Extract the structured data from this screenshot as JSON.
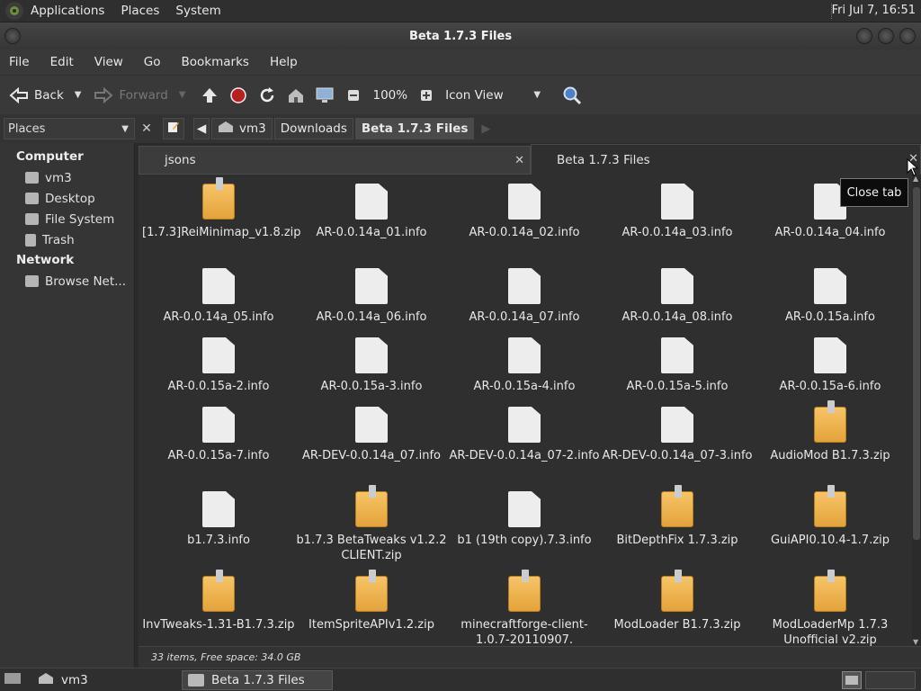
{
  "panel": {
    "menu": [
      "Applications",
      "Places",
      "System"
    ],
    "clock": "Fri Jul  7, 16:51"
  },
  "window": {
    "title": "Beta 1.7.3 Files"
  },
  "menubar": [
    "File",
    "Edit",
    "View",
    "Go",
    "Bookmarks",
    "Help"
  ],
  "toolbar": {
    "back": "Back",
    "forward": "Forward",
    "zoom": "100%",
    "view": "Icon View"
  },
  "sidebar": {
    "selector": "Places",
    "sections": [
      {
        "title": "Computer",
        "items": [
          "vm3",
          "Desktop",
          "File System",
          "Trash"
        ]
      },
      {
        "title": "Network",
        "items": [
          "Browse Net..."
        ]
      }
    ]
  },
  "breadcrumbs": [
    "vm3",
    "Downloads",
    "Beta 1.7.3 Files"
  ],
  "tabs": [
    {
      "label": "jsons",
      "active": false
    },
    {
      "label": "Beta 1.7.3 Files",
      "active": true
    }
  ],
  "tooltip": "Close tab",
  "files": [
    {
      "name": "[1.7.3]ReiMinimap_v1.8.zip",
      "type": "zip"
    },
    {
      "name": "AR-0.0.14a_01.info",
      "type": "doc"
    },
    {
      "name": "AR-0.0.14a_02.info",
      "type": "doc"
    },
    {
      "name": "AR-0.0.14a_03.info",
      "type": "doc"
    },
    {
      "name": "AR-0.0.14a_04.info",
      "type": "doc"
    },
    {
      "name": "AR-0.0.14a_05.info",
      "type": "doc"
    },
    {
      "name": "AR-0.0.14a_06.info",
      "type": "doc"
    },
    {
      "name": "AR-0.0.14a_07.info",
      "type": "doc"
    },
    {
      "name": "AR-0.0.14a_08.info",
      "type": "doc"
    },
    {
      "name": "AR-0.0.15a.info",
      "type": "doc"
    },
    {
      "name": "AR-0.0.15a-2.info",
      "type": "doc"
    },
    {
      "name": "AR-0.0.15a-3.info",
      "type": "doc"
    },
    {
      "name": "AR-0.0.15a-4.info",
      "type": "doc"
    },
    {
      "name": "AR-0.0.15a-5.info",
      "type": "doc"
    },
    {
      "name": "AR-0.0.15a-6.info",
      "type": "doc"
    },
    {
      "name": "AR-0.0.15a-7.info",
      "type": "doc"
    },
    {
      "name": "AR-DEV-0.0.14a_07.info",
      "type": "doc"
    },
    {
      "name": "AR-DEV-0.0.14a_07-2.info",
      "type": "doc"
    },
    {
      "name": "AR-DEV-0.0.14a_07-3.info",
      "type": "doc"
    },
    {
      "name": "AudioMod B1.7.3.zip",
      "type": "zip"
    },
    {
      "name": "b1.7.3.info",
      "type": "doc"
    },
    {
      "name": "b1.7.3 BetaTweaks v1.2.2 CLIENT.zip",
      "type": "zip"
    },
    {
      "name": "b1 (19th copy).7.3.info",
      "type": "doc"
    },
    {
      "name": "BitDepthFix 1.7.3.zip",
      "type": "zip"
    },
    {
      "name": "GuiAPI0.10.4-1.7.zip",
      "type": "zip"
    },
    {
      "name": "InvTweaks-1.31-B1.7.3.zip",
      "type": "zip"
    },
    {
      "name": "ItemSpriteAPIv1.2.zip",
      "type": "zip"
    },
    {
      "name": "minecraftforge-client-1.0.7-20110907.",
      "type": "zip"
    },
    {
      "name": "ModLoader B1.7.3.zip",
      "type": "zip"
    },
    {
      "name": "ModLoaderMp 1.7.3 Unofficial v2.zip",
      "type": "zip"
    }
  ],
  "status": "33 items, Free space: 34.0 GB",
  "taskbar": {
    "desktop_label": "vm3",
    "task": "Beta 1.7.3 Files"
  }
}
